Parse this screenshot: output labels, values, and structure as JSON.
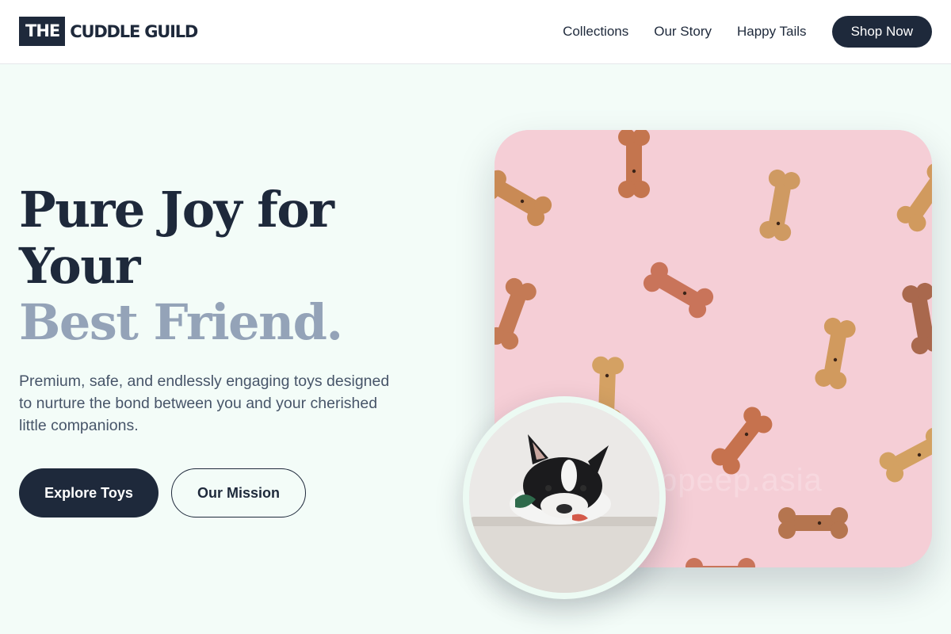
{
  "brand": {
    "logo_box": "THE",
    "logo_text": "CUDDLE GUILD"
  },
  "nav": {
    "links": [
      "Collections",
      "Our Story",
      "Happy Tails"
    ],
    "cta": "Shop Now"
  },
  "hero": {
    "headline_line1": "Pure Joy for",
    "headline_line2": "Your",
    "headline_accent": "Best Friend.",
    "subtitle": "Premium, safe, and endlessly engaging toys designed to nurture the bond between you and your cherished little companions.",
    "primary_button": "Explore Toys",
    "secondary_button": "Our Mission"
  },
  "images": {
    "main_watermark": "peeppeep.asia",
    "main_subject": "dog bone biscuits on pink background",
    "inset_subject": "french bulldog lying on cushion"
  },
  "colors": {
    "navy": "#1e293b",
    "accent_text": "#94a3b8",
    "page_background": "#f3fcf8",
    "photo_pink": "#f5ced6"
  }
}
